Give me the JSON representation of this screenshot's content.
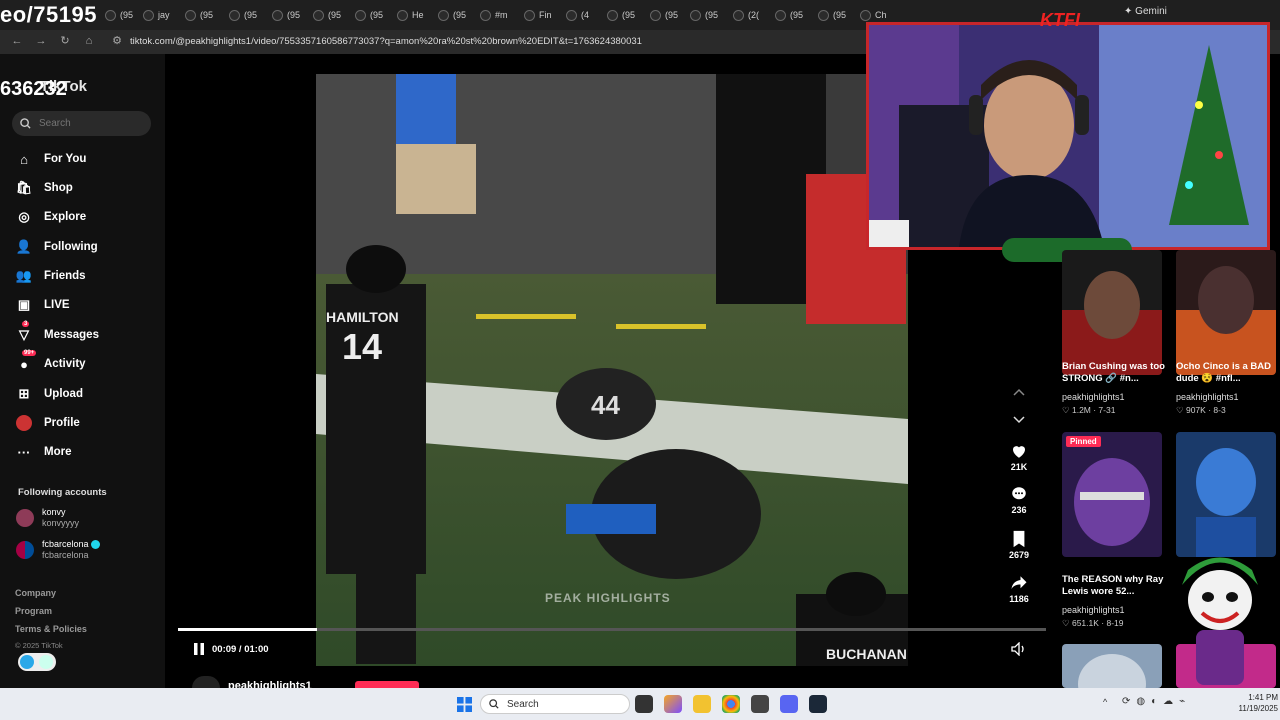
{
  "browser": {
    "overlay_title": "eo/75195",
    "tabs": [
      "(95",
      "jay",
      "(95",
      "(95",
      "(95",
      "(95",
      "(95",
      "He",
      "(95",
      "#m",
      "Fin",
      "(4",
      "(95",
      "(95",
      "(95",
      "(2(",
      "(95",
      "(95",
      "Ch"
    ],
    "gemini_label": "Gemini",
    "url": "tiktok.com/@peakhighlights1/video/7553357160586773037?q=amon%20ra%20st%20brown%20EDIT&t=1763624380031"
  },
  "sidebar": {
    "overlay_number": "636232",
    "logo_text": "TikTok",
    "search_placeholder": "Search",
    "items": [
      {
        "label": "For You",
        "icon": "home-icon"
      },
      {
        "label": "Shop",
        "icon": "shop-icon"
      },
      {
        "label": "Explore",
        "icon": "compass-icon"
      },
      {
        "label": "Following",
        "icon": "following-icon"
      },
      {
        "label": "Friends",
        "icon": "friends-icon"
      },
      {
        "label": "LIVE",
        "icon": "live-icon"
      },
      {
        "label": "Messages",
        "icon": "messages-icon",
        "badge": "3"
      },
      {
        "label": "Activity",
        "icon": "activity-icon",
        "badge": "99+"
      },
      {
        "label": "Upload",
        "icon": "upload-icon"
      },
      {
        "label": "Profile",
        "icon": "profile-icon"
      },
      {
        "label": "More",
        "icon": "more-icon"
      }
    ],
    "following_header": "Following accounts",
    "accounts": [
      {
        "name": "konvy",
        "handle": "konvyyyy",
        "color": "#8e3b58"
      },
      {
        "name": "fcbarcelona",
        "handle": "fcbarcelona",
        "color": "#a50044",
        "verified": true
      }
    ],
    "footer": [
      "Company",
      "Program",
      "Terms & Policies"
    ],
    "copyright": "© 2025 TikTok"
  },
  "video": {
    "watermark": "PEAK HIGHLIGHTS",
    "time": "00:09 / 01:00",
    "progress": 0.16,
    "jersey_left_name": "HAMILTON",
    "jersey_left_number": "14",
    "jersey_bottom_name": "BUCHANAN",
    "channel_name": "peakhighlights1"
  },
  "actions": {
    "likes": "21K",
    "comments": "236",
    "saves": "2679",
    "shares": "1186"
  },
  "grid": [
    {
      "title": "Brian Cushing was too STRONG 🔗 #n...",
      "user": "peakhighlights1",
      "stats": "♡ 1.2M · 7-31",
      "colors": [
        "#1a1a1a",
        "#8b1a1a"
      ]
    },
    {
      "title": "Ocho Cinco is a BAD dude 😵 #nfl...",
      "user": "peakhighlights1",
      "stats": "♡ 907K · 8-3",
      "colors": [
        "#2b1a1a",
        "#c8531f"
      ]
    },
    {
      "title": "The REASON why Ray Lewis wore 52...",
      "user": "peakhighlights1",
      "stats": "♡ 651.1K · 8-19",
      "colors": [
        "#2a1a4a",
        "#6d3fa0"
      ],
      "pinned": "Pinned"
    },
    {
      "title": "",
      "user": "",
      "stats": "",
      "colors": [
        "#1a3a6a",
        "#3a7bd5"
      ]
    }
  ],
  "webcam": {
    "brand": "KTFI"
  },
  "taskbar": {
    "search_placeholder": "Search",
    "time": "1:41 PM",
    "date": "11/19/2025"
  }
}
